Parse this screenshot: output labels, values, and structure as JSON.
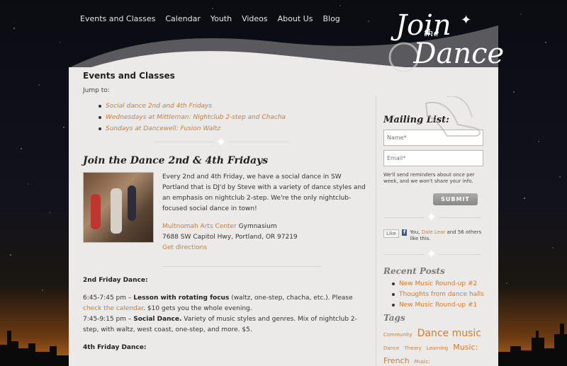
{
  "nav": [
    "Events and Classes",
    "Calendar",
    "Youth",
    "Videos",
    "About Us",
    "Blog"
  ],
  "logo": {
    "main": "Join the Dance",
    "small": "the"
  },
  "page_title": "Events and Classes",
  "jump_label": "Jump to:",
  "jump_links": [
    "Social dance 2nd and 4th Fridays",
    "Wednesdays at Mittleman: Nightclub 2-step and Chacha",
    "Sundays at Dancewell: Fusion Waltz"
  ],
  "section_title": "Join the Dance 2nd & 4th Fridays",
  "intro": "Every 2nd and 4th Friday, we have a social dance in SW Portland that is DJ'd by Steve with a variety of dance styles and an emphasis on nightclub 2-step. We're the only nightclub-focused social dance in town!",
  "venue": {
    "name": "Multnomah Arts Center",
    "room": " Gymnasium",
    "address": "7688 SW Capitol Hwy, Portland, OR 97219",
    "directions": "Get directions"
  },
  "second_friday": {
    "heading": "2nd Friday Dance:",
    "lesson_time": "6:45-7:45 pm – ",
    "lesson_title": "Lesson with rotating focus",
    "lesson_desc": " (waltz, one-step, chacha, etc.).  Please ",
    "calendar_link": "check the calendar",
    "lesson_price": ". $10 gets you the whole evening.",
    "social_time": "7:45-9:15 pm – ",
    "social_title": "Social Dance.",
    "social_desc": " Variety of music styles and genres. Mix of nightclub 2-step, with waltz, west coast, one-step, and more. $5."
  },
  "fourth_friday_heading": "4th Friday Dance:",
  "sidebar": {
    "mailing_title": "Mailing List:",
    "name_placeholder": "Name*",
    "email_placeholder": "Email*",
    "notice": "We'll send reminders about once per week, and we won't share your info.",
    "submit": "SUBMIT",
    "like": {
      "button": "Like",
      "you": "You, ",
      "friend": "Dale Lear",
      "rest": " and 56 others like this."
    },
    "recent_title": "Recent Posts",
    "recent_posts": [
      "New Music Round-up #2",
      "Thoughts from dance halls",
      "New Music Round-up #1"
    ],
    "tags_title": "Tags",
    "tags": [
      {
        "label": "Community",
        "size": "7px"
      },
      {
        "label": "Dance music",
        "size": "14px"
      },
      {
        "label": "Dance",
        "size": "7px"
      },
      {
        "label": "Theory",
        "size": "7px"
      },
      {
        "label": "Learning",
        "size": "7px"
      },
      {
        "label": "Music: French",
        "size": "11px"
      },
      {
        "label": "Music:",
        "size": "7px"
      }
    ]
  },
  "colors": {
    "accent": "#d97c2b",
    "panel": "#ebeae8"
  }
}
